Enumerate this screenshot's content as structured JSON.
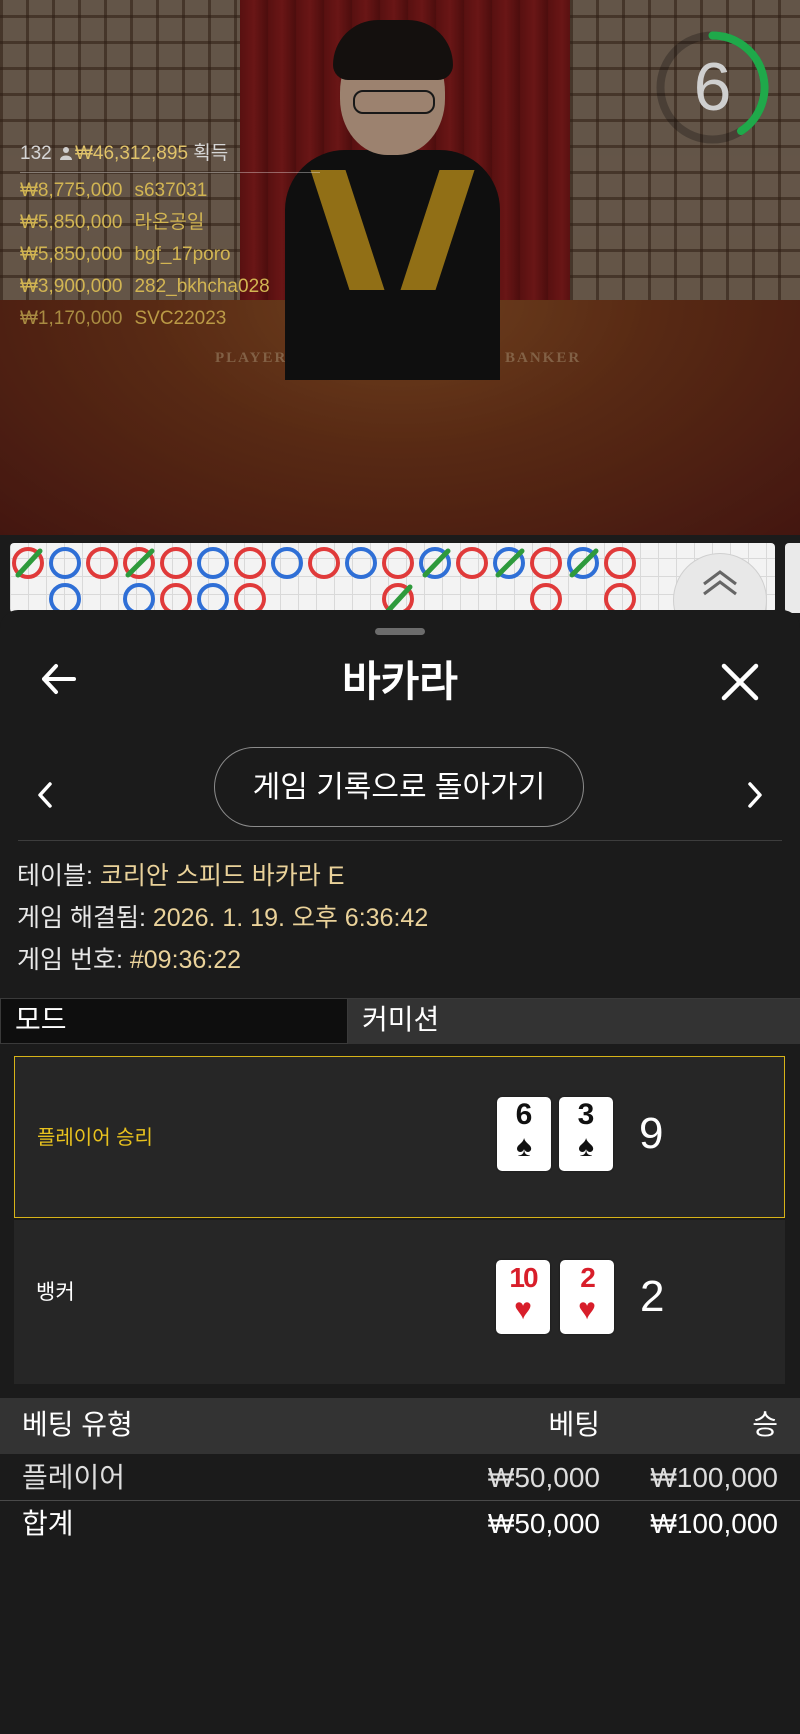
{
  "video": {
    "player_count": "132",
    "total_win": "₩46,312,895",
    "total_win_suffix": "획득",
    "countdown": "6",
    "felt_player_label": "PLAYER",
    "felt_banker_label": "BANKER",
    "winners": [
      {
        "amount": "₩8,775,000",
        "name": "s637031"
      },
      {
        "amount": "₩5,850,000",
        "name": "라온공일"
      },
      {
        "amount": "₩5,850,000",
        "name": "bgf_17poro"
      },
      {
        "amount": "₩3,900,000",
        "name": "282_bkhcha028"
      },
      {
        "amount": "₩1,170,000",
        "name": "SVC22023"
      }
    ]
  },
  "colors": {
    "player": "#2f6fd6",
    "banker": "#e03a3a",
    "tie": "#2e9a3c",
    "win_border": "#d7b318",
    "timer": "#1fa94a"
  },
  "sheet": {
    "title": "바카라",
    "back_icon": "arrow-left-icon",
    "close_icon": "close-icon",
    "nav_button": "게임 기록으로 돌아가기",
    "info": {
      "table_label": "테이블:",
      "table_value": "코리안 스피드 바카라 E",
      "resolved_label": "게임 해결됨:",
      "resolved_value": "2026. 1. 19. 오후 6:36:42",
      "game_no_label": "게임 번호:",
      "game_no_value": "#09:36:22"
    },
    "tabs": {
      "mode": "모드",
      "commission": "커미션"
    },
    "player": {
      "label": "플레이어 승리",
      "score": "9",
      "cards": [
        {
          "rank": "6",
          "suit": "♠"
        },
        {
          "rank": "3",
          "suit": "♠"
        }
      ]
    },
    "banker": {
      "label": "뱅커",
      "score": "2",
      "cards": [
        {
          "rank": "10",
          "suit": "♥"
        },
        {
          "rank": "2",
          "suit": "♥"
        }
      ]
    },
    "bets": {
      "headers": {
        "type": "베팅 유형",
        "bet": "베팅",
        "win": "승"
      },
      "rows": [
        {
          "type": "플레이어",
          "bet": "₩50,000",
          "win": "₩100,000"
        }
      ],
      "total": {
        "type": "합계",
        "bet": "₩50,000",
        "win": "₩100,000"
      }
    }
  }
}
